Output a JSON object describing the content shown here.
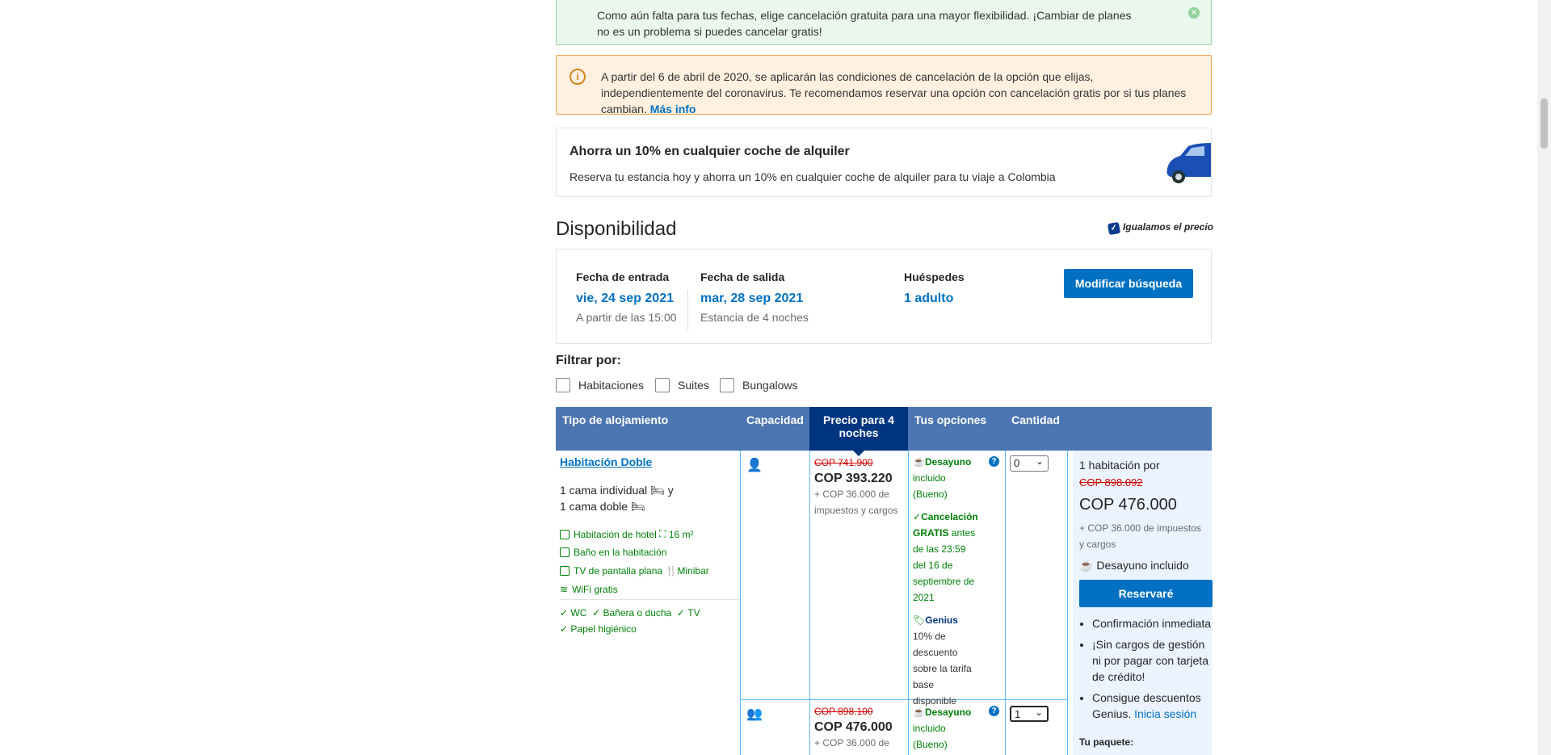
{
  "notices": {
    "green": "Como aún falta para tus fechas, elige cancelación gratuita para una mayor flexibilidad. ¡Cambiar de planes no es un problema si puedes cancelar gratis!",
    "orange": "A partir del 6 de abril de 2020, se aplicarán las condiciones de cancelación de la opción que elijas, independientemente del coronavirus. Te recomendamos reservar una opción con cancelación gratis por si tus planes cambian.",
    "orange_link": "Más info"
  },
  "promo": {
    "title": "Ahorra un 10% en cualquier coche de alquiler",
    "text": "Reserva tu estancia hoy y ahorra un 10% en cualquier coche de alquiler para tu viaje a Colombia"
  },
  "availability": {
    "title": "Disponibilidad",
    "price_match": "Igualamos el precio",
    "checkin_label": "Fecha de entrada",
    "checkin_value": "vie, 24 sep 2021",
    "checkin_sub": "A partir de las 15:00",
    "checkout_label": "Fecha de salida",
    "checkout_value": "mar, 28 sep 2021",
    "checkout_sub": "Estancia de 4 noches",
    "guests_label": "Huéspedes",
    "guests_value": "1 adulto",
    "modify_button": "Modificar búsqueda"
  },
  "filters": {
    "label": "Filtrar por:",
    "options": [
      "Habitaciones",
      "Suites",
      "Bungalows"
    ]
  },
  "table": {
    "headers": [
      "Tipo de alojamiento",
      "Capacidad",
      "Precio para 4 noches",
      "Tus opciones",
      "Cantidad"
    ],
    "room": {
      "name": "Habitación Doble",
      "bed1": "1 cama individual",
      "bed_join": "y",
      "bed2": "1 cama doble",
      "facilities": [
        "Habitación de hotel",
        "16 m²",
        "Baño en la habitación",
        "TV de pantalla plana",
        "Minibar",
        "WiFi gratis"
      ],
      "amenities": [
        "WC",
        "Bañera o ducha",
        "TV",
        "Papel higiénico"
      ]
    },
    "row1": {
      "old_price": "COP 741.900",
      "price": "COP 393.220",
      "tax": "+ COP 36.000 de impuestos y cargos",
      "breakfast_b": "Desayuno",
      "breakfast": "incluido (Bueno)",
      "cancel_b": "Cancelación GRATIS",
      "cancel": "antes de las 23:59 del 16 de septiembre de 2021",
      "genius_b": "Genius",
      "genius": "10% de descuento sobre la tarifa base disponible",
      "qty": "0"
    },
    "row2": {
      "old_price": "COP 898.100",
      "price": "COP 476.000",
      "tax": "+ COP 36.000 de",
      "breakfast_b": "Desayuno",
      "breakfast": "incluido (Bueno)",
      "qty": "1"
    },
    "summary": {
      "rooms_for": "1 habitación por",
      "old_price": "COP 898.092",
      "price": "COP 476.000",
      "tax": "+ COP 36.000 de impuestos y cargos",
      "breakfast": "Desayuno incluido",
      "reserve_button": "Reservaré",
      "bullets": [
        "Confirmación inmediata",
        "¡Sin cargos de gestión ni por pagar con tarjeta de crédito!",
        "Consigue descuentos Genius."
      ],
      "login_link": "Inicia sesión",
      "package": "Tu paquete:"
    }
  }
}
